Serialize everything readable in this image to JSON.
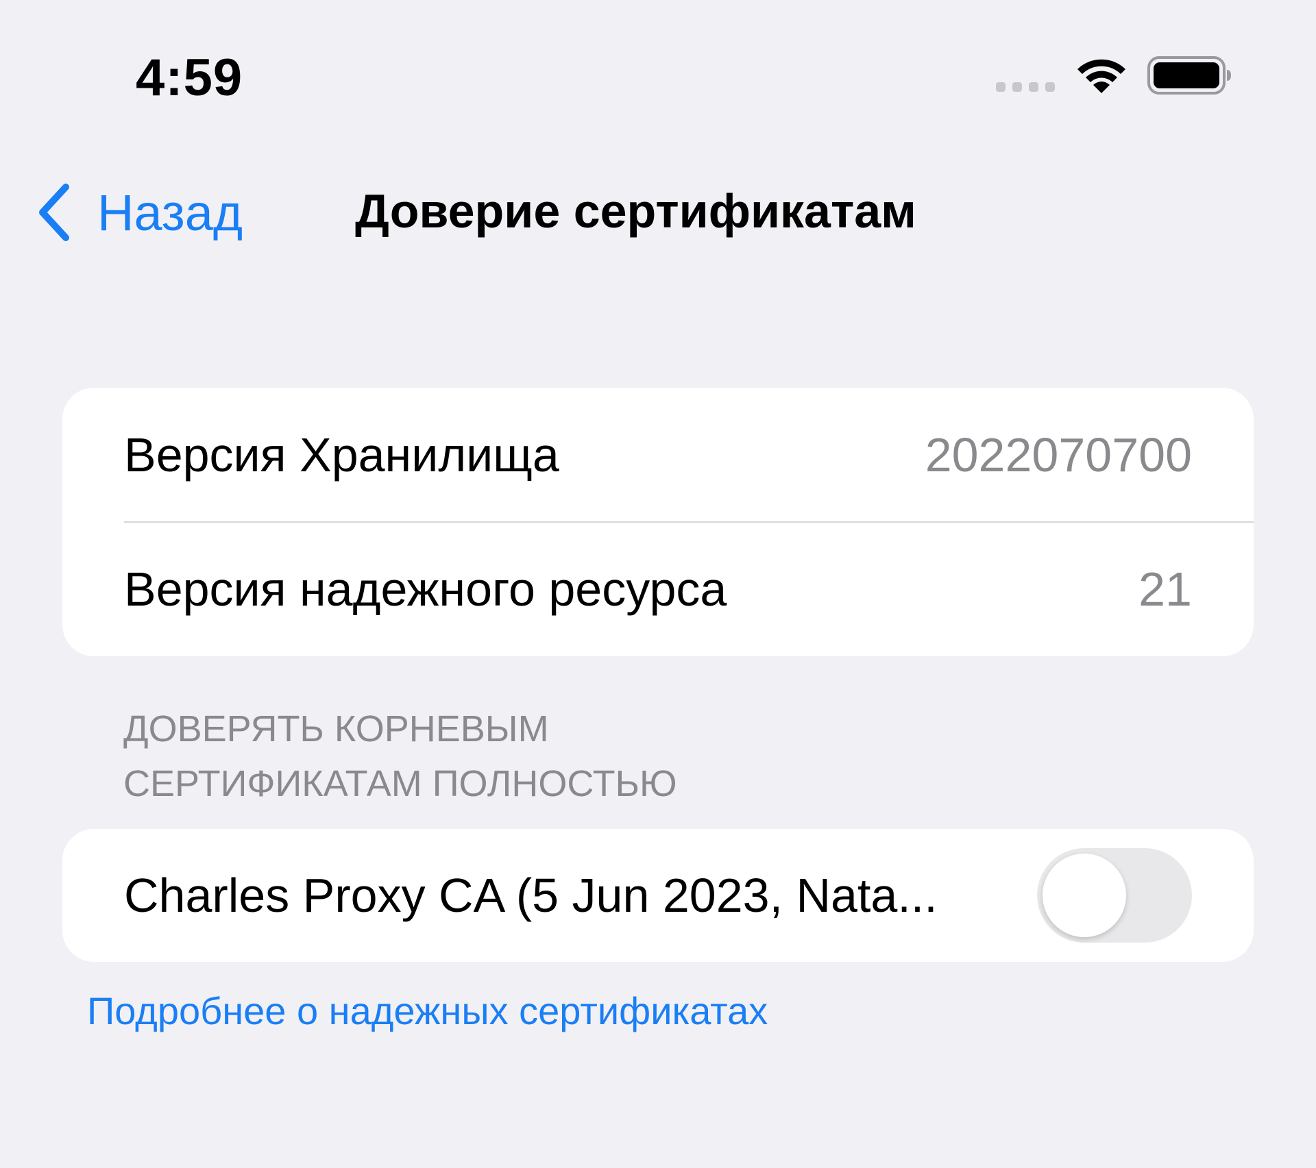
{
  "status_bar": {
    "time": "4:59"
  },
  "nav": {
    "back_label": "Назад",
    "title": "Доверие сертификатам"
  },
  "info_rows": [
    {
      "label": "Версия Хранилища",
      "value": "2022070700"
    },
    {
      "label": "Версия надежного ресурса",
      "value": "21"
    }
  ],
  "section": {
    "header_line1": "ДОВЕРЯТЬ КОРНЕВЫМ",
    "header_line2": "СЕРТИФИКАТАМ ПОЛНОСТЬЮ"
  },
  "certificate": {
    "label": "Charles Proxy CA (5 Jun 2023, Nata...",
    "enabled": false
  },
  "footer": {
    "link_text": "Подробнее о надежных сертификатах"
  },
  "colors": {
    "accent": "#1a7ef5",
    "background": "#f1f1f5",
    "secondary_text": "#8a8a8e"
  },
  "icons": {
    "back": "chevron-left-icon",
    "wifi": "wifi-icon",
    "battery": "battery-icon",
    "signal": "cellular-signal-icon"
  }
}
